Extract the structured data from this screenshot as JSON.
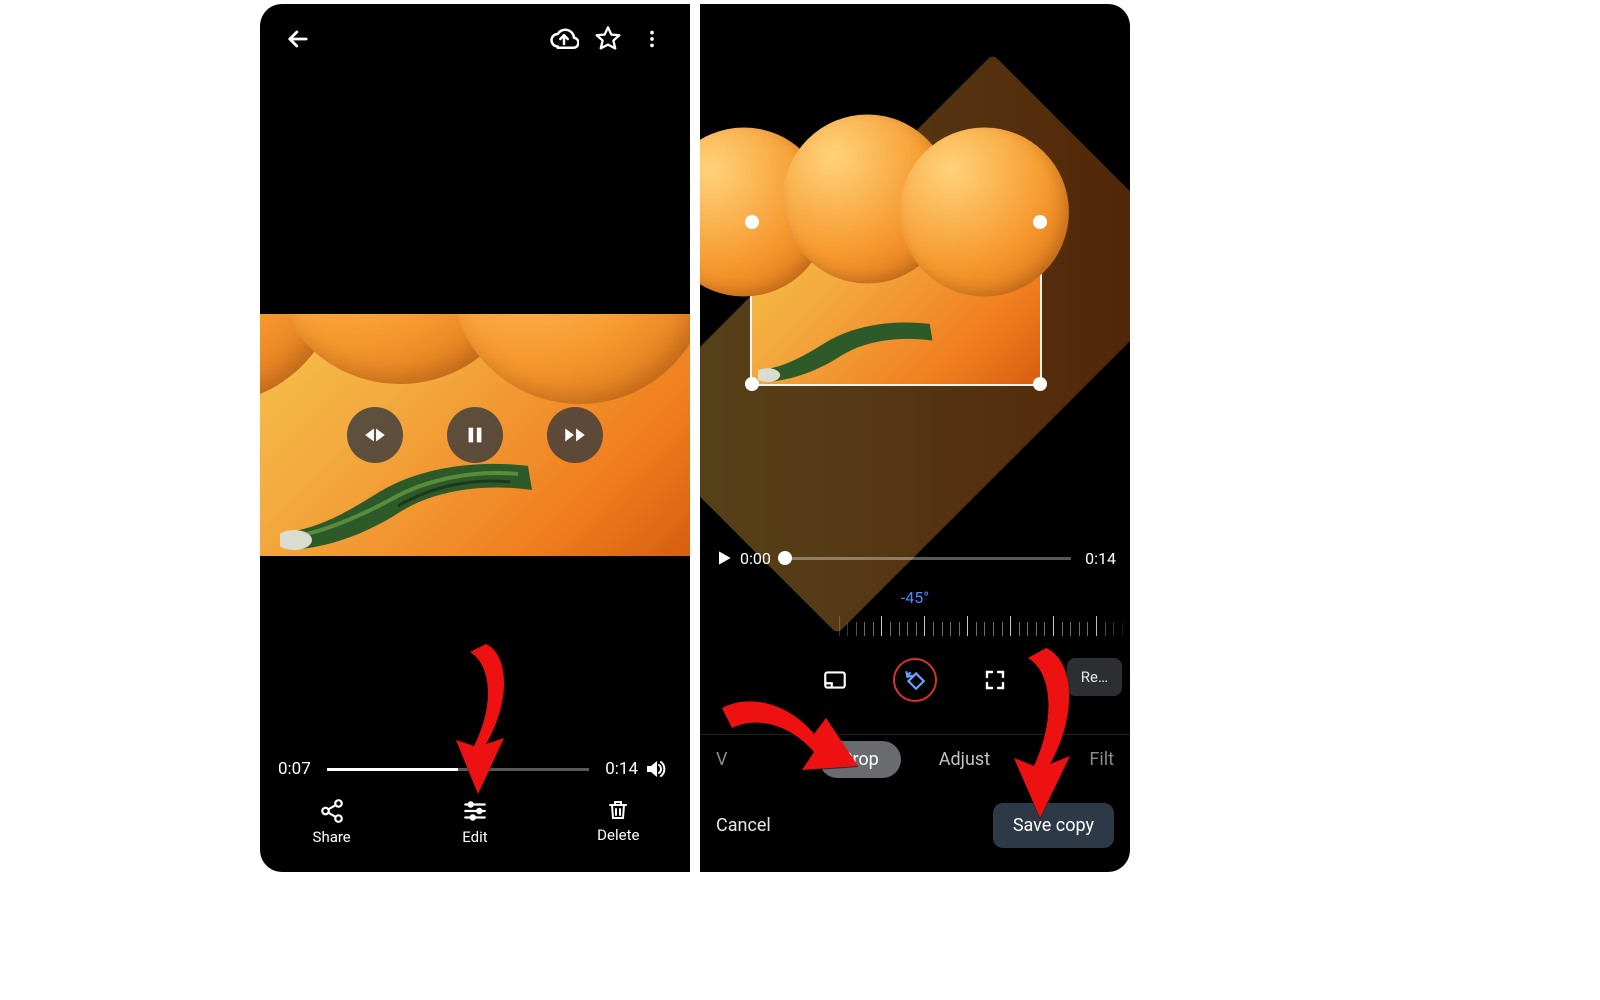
{
  "colors": {
    "accent_red": "#e11111",
    "accent_blue": "#4a8bff"
  },
  "left": {
    "progress": {
      "current": "0:07",
      "total": "0:14",
      "fill_pct": 50
    },
    "actions": {
      "share": "Share",
      "edit": "Edit",
      "delete": "Delete"
    }
  },
  "right": {
    "progress": {
      "current": "0:00",
      "total": "0:14"
    },
    "angle_label": "-45°",
    "reset_chip": "Re…",
    "tabs": {
      "left_partial": "V",
      "crop": "Crop",
      "adjust": "Adjust",
      "right_partial": "Filt"
    },
    "footer": {
      "cancel": "Cancel",
      "save": "Save copy"
    }
  }
}
